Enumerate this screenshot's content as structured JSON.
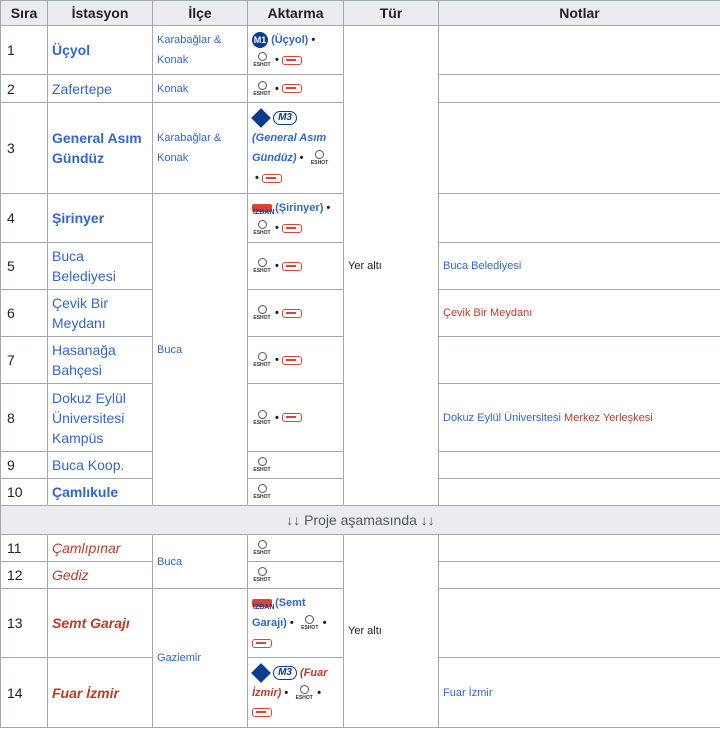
{
  "headers": {
    "sira": "Sıra",
    "istasyon": "İstasyon",
    "ilce": "İlçe",
    "aktarma": "Aktarma",
    "tur": "Tür",
    "notlar": "Notlar"
  },
  "rows": [
    {
      "no": "1",
      "name": "Üçyol"
    },
    {
      "no": "2",
      "name": "Zafertepe"
    },
    {
      "no": "3",
      "name": "General Asım Gündüz"
    },
    {
      "no": "4",
      "name": "Şirinyer"
    },
    {
      "no": "5",
      "name": "Buca Belediyesi"
    },
    {
      "no": "6",
      "name": "Çevik Bir Meydanı"
    },
    {
      "no": "7",
      "name": "Hasanağa Bahçesi"
    },
    {
      "no": "8",
      "name": "Dokuz Eylül Üniversitesi Kampüs"
    },
    {
      "no": "9",
      "name": "Buca Koop."
    },
    {
      "no": "10",
      "name": "Çamlıkule"
    },
    {
      "no": "11",
      "name": "Çamlıpınar"
    },
    {
      "no": "12",
      "name": "Gediz"
    },
    {
      "no": "13",
      "name": "Semt Garajı"
    },
    {
      "no": "14",
      "name": "Fuar İzmir"
    }
  ],
  "ilce": {
    "karabaglar_konak": "Karabağlar & Konak",
    "konak": "Konak",
    "buca": "Buca",
    "buca2": "Buca",
    "gaziemir": "Gaziemir"
  },
  "aktarma": {
    "m1_badge": "M1",
    "r1_link": "(Üçyol)",
    "m3_badge": "M3",
    "r3_link": "(General Asım Gündüz)",
    "izban_badge": "İZBAN",
    "r4_link": "(Şirinyer)",
    "r13_link": "(Semt Garajı)",
    "r14_link": "(Fuar İzmir)",
    "eshot_label": "ESHOT"
  },
  "tur": {
    "group1": "Yer altı",
    "group2": "Yer altı"
  },
  "notlar": {
    "r5": "Buca Belediyesi",
    "r6": "Çevik Bir Meydanı",
    "r8_part1": "Dokuz Eylül Üniversitesi",
    "r8_part2": "Merkez Yerleşkesi",
    "r14": "Fuar İzmir"
  },
  "separator": "↓↓ Proje aşamasında ↓↓",
  "colors": {
    "link_blue": "#3366cc",
    "link_red": "#ba3c2a",
    "header_bg": "#eaecf0",
    "border": "#a2a9b1",
    "metro_blue": "#0b3b8c",
    "izban_red": "#d8453a"
  }
}
